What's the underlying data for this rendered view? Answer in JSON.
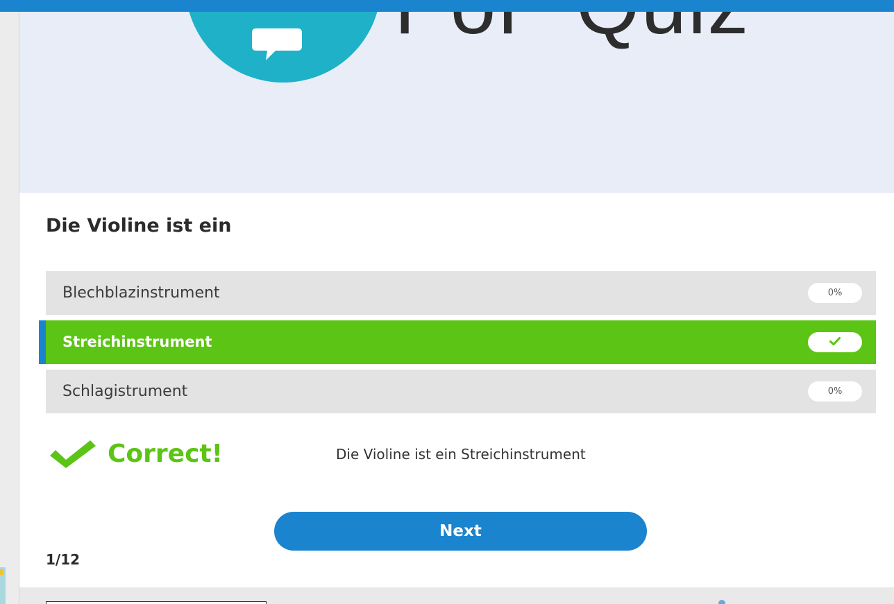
{
  "banner": {
    "logo_text": "PoP Quiz",
    "logo_icon": "speech-bubble-icon"
  },
  "question": {
    "text": "Die Violine ist ein"
  },
  "answers": [
    {
      "label": "Blechblazinstrument",
      "badge": "0%",
      "state": "incorrect"
    },
    {
      "label": "Streichinstrument",
      "badge_icon": "check-icon",
      "state": "correct"
    },
    {
      "label": "Schlagistrument",
      "badge": "0%",
      "state": "incorrect"
    }
  ],
  "feedback": {
    "icon": "check-icon",
    "title": "Correct!",
    "text": "Die Violine ist ein Streichinstrument"
  },
  "navigation": {
    "next_label": "Next",
    "progress": "1/12"
  },
  "colors": {
    "accent_blue": "#1a84cf",
    "correct_green": "#5cc414",
    "banner_bg": "#e8edf8",
    "logo_teal": "#1fb1c7"
  }
}
